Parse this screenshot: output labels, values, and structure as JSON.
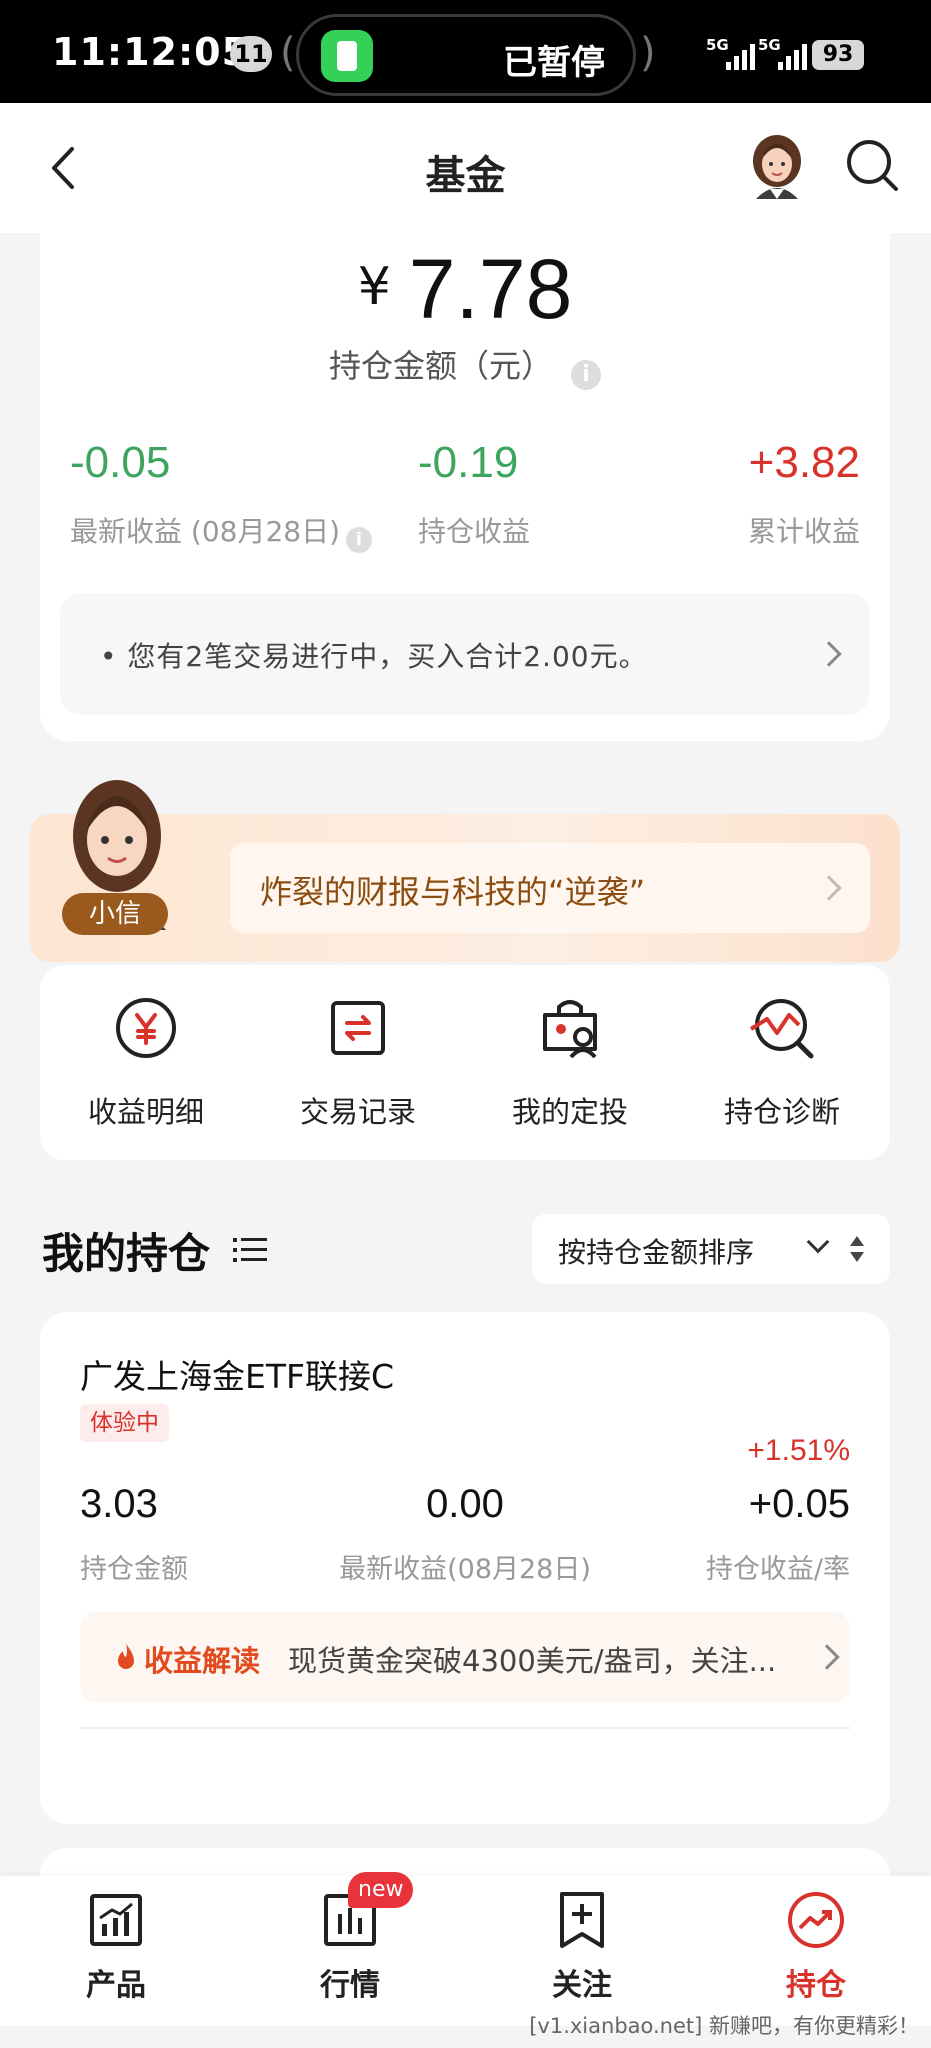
{
  "status_bar": {
    "time": "11:12:05",
    "notification_count": "11",
    "live_activity": "已暂停",
    "signal_1": "5G",
    "signal_2": "5G",
    "battery": "93"
  },
  "header": {
    "title": "基金",
    "icons": [
      "back-icon",
      "assistant-avatar",
      "search-icon"
    ]
  },
  "summary": {
    "currency": "¥",
    "total_amount": "7.78",
    "total_label": "持仓金额（元）",
    "stats": [
      {
        "value": "-0.05",
        "label": "最新收益 (08月28日)",
        "tone": "green"
      },
      {
        "value": "-0.19",
        "label": "持仓收益",
        "tone": "green"
      },
      {
        "value": "+3.82",
        "label": "累计收益",
        "tone": "red"
      }
    ],
    "notice": "• 您有2笔交易进行中，买入合计2.00元。"
  },
  "banner": {
    "assistant_name": "小信",
    "text": "炸裂的财报与科技的“逆袭”"
  },
  "actions": [
    {
      "label": "收益明细",
      "icon": "yen-circle-icon"
    },
    {
      "label": "交易记录",
      "icon": "exchange-icon"
    },
    {
      "label": "我的定投",
      "icon": "auto-invest-icon"
    },
    {
      "label": "持仓诊断",
      "icon": "diagnosis-icon"
    }
  ],
  "holdings": {
    "title": "我的持仓",
    "sort_label": "按持仓金额排序",
    "fund": {
      "name": "广发上海金ETF联接C",
      "badge": "体验中",
      "rate": "+1.51%",
      "amount": "3.03",
      "amount_label": "持仓金额",
      "latest": "0.00",
      "latest_label": "最新收益(08月28日)",
      "profit": "+0.05",
      "profit_label": "持仓收益/率",
      "insight_label": "收益解读",
      "insight_text": "现货黄金突破4300美元/盎司，关注..."
    }
  },
  "bottom_nav": {
    "items": [
      {
        "label": "产品",
        "icon": "product-chart-icon"
      },
      {
        "label": "行情",
        "icon": "market-icon"
      },
      {
        "label": "关注",
        "icon": "bookmark-plus-icon"
      },
      {
        "label": "持仓",
        "icon": "holdings-icon"
      }
    ],
    "new_badge": "new",
    "active_index": 3
  },
  "watermark": "[v1.xianbao.net] 新赚吧，有你更精彩！",
  "colors": {
    "red": "#d8322b",
    "green": "#3da55f",
    "banner_text": "#8b4d12"
  }
}
